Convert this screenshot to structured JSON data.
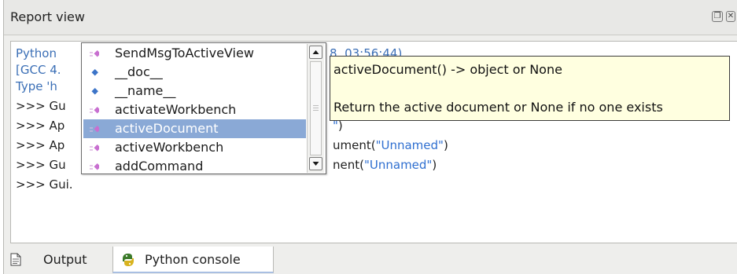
{
  "panel": {
    "title": "Report view",
    "float_icon": "float-window-icon",
    "close_icon": "close-window-icon"
  },
  "console": {
    "lines": [
      {
        "left": "Python ",
        "right": "8, 03:56:44)"
      },
      {
        "left": "[GCC 4.",
        "right": ""
      },
      {
        "left": "Type 'h",
        "right": ""
      },
      {
        "left": ">>> Gu",
        "right": ""
      },
      {
        "left": ">>> Ap",
        "right_code": ")",
        "right_str": "\""
      },
      {
        "left": ">>> Ap",
        "right_code": "ument(",
        "right_str": "\"Unnamed\"",
        "right_end": ")"
      },
      {
        "left": ">>> Gu",
        "right_code": "nent(",
        "right_str": "\"Unnamed\"",
        "right_end": ")"
      },
      {
        "left": ">>> Gui.",
        "right": ""
      }
    ]
  },
  "autocomplete": {
    "items": [
      {
        "label": "SendMsgToActiveView",
        "icon": "method-icon"
      },
      {
        "label": "__doc__",
        "icon": "attribute-icon"
      },
      {
        "label": "__name__",
        "icon": "attribute-icon"
      },
      {
        "label": "activateWorkbench",
        "icon": "method-icon"
      },
      {
        "label": "activeDocument",
        "icon": "method-icon",
        "selected": true
      },
      {
        "label": "activeWorkbench",
        "icon": "method-icon"
      },
      {
        "label": "addCommand",
        "icon": "method-icon"
      }
    ]
  },
  "calltip": {
    "signature": "activeDocument() -> object or None",
    "description": "Return the active document or None if no one exists"
  },
  "tabs": [
    {
      "label": "Output",
      "icon": "document-icon",
      "active": false
    },
    {
      "label": "Python console",
      "icon": "python-icon",
      "active": true
    }
  ],
  "colors": {
    "selection": "#8aa9d6",
    "calltip_bg": "#ffffe0",
    "method_icon": "#c86fd0",
    "attribute_icon": "#3c74c8",
    "string": "#2f6fd0"
  }
}
